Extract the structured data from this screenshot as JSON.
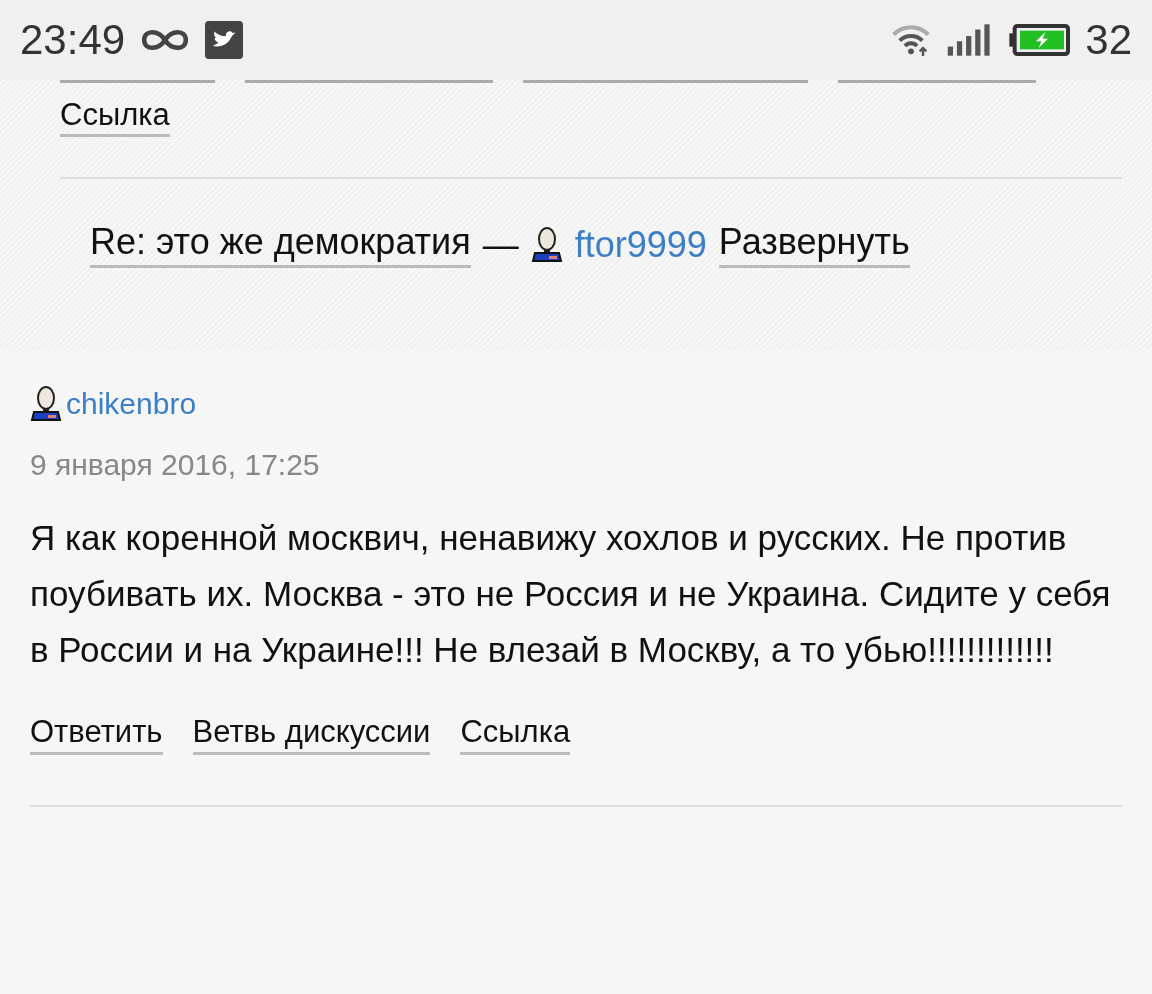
{
  "status_bar": {
    "time": "23:49",
    "battery_percent": "32"
  },
  "previous_comment": {
    "links": [
      {
        "label": "Ссылка"
      }
    ]
  },
  "collapsed_reply": {
    "title": "Re: это же демократия",
    "separator": "—",
    "author": "ftor9999",
    "expand": "Развернуть"
  },
  "comment": {
    "author": "chikenbro",
    "date": "9 января 2016, 17:25",
    "text": "Я как коренной москвич, ненавижу хохлов и русских. Не против поубивать их. Москва - это не Россия и не Украина. Сидите у себя в России и на Украине!!! Не влезай в Москву, а то убью!!!!!!!!!!!!!",
    "actions": [
      {
        "label": "Ответить"
      },
      {
        "label": "Ветвь дискуссии"
      },
      {
        "label": "Ссылка"
      }
    ]
  }
}
